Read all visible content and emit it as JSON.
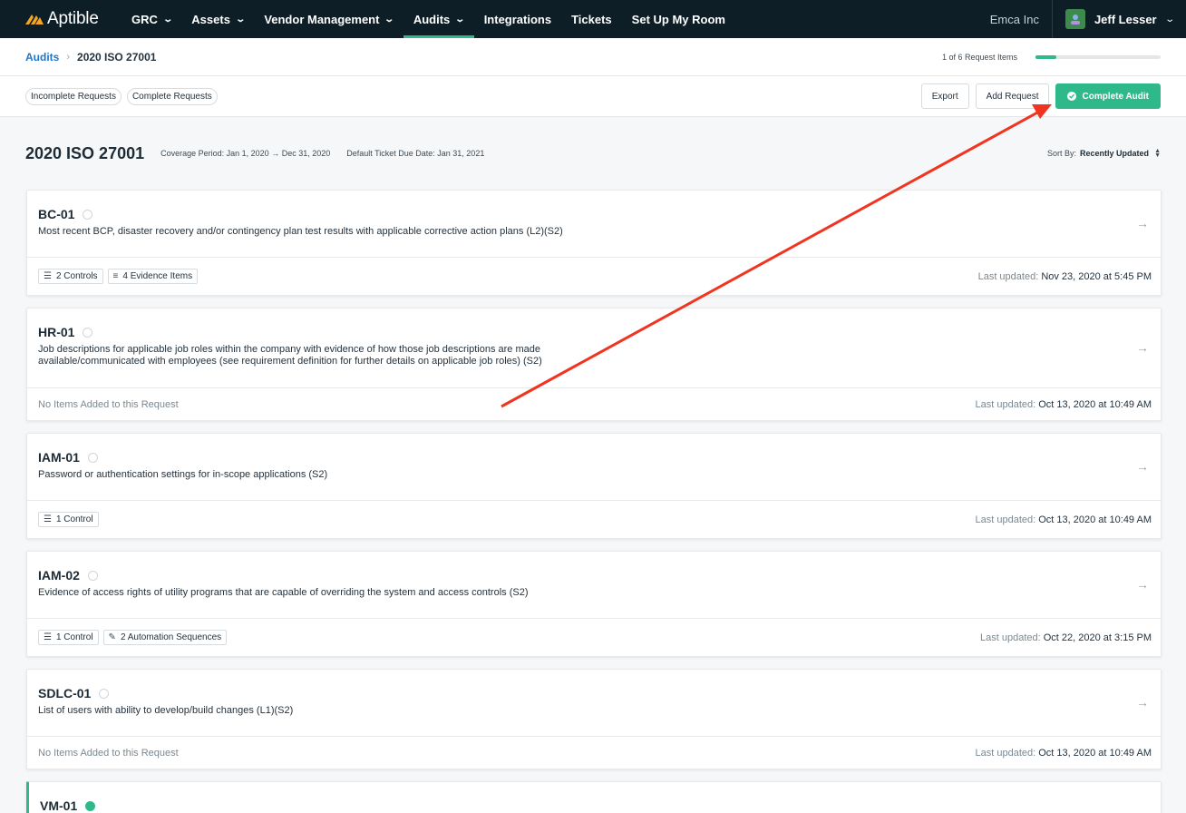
{
  "app": {
    "brand": "Aptible",
    "accent": "#2fb98a"
  },
  "nav": {
    "items": [
      {
        "label": "GRC",
        "dropdown": true
      },
      {
        "label": "Assets",
        "dropdown": true
      },
      {
        "label": "Vendor Management",
        "dropdown": true
      },
      {
        "label": "Audits",
        "dropdown": true,
        "active": true
      },
      {
        "label": "Integrations",
        "dropdown": false
      },
      {
        "label": "Tickets",
        "dropdown": false
      },
      {
        "label": "Set Up My Room",
        "dropdown": false
      }
    ],
    "org": "Emca Inc",
    "user": "Jeff Lesser"
  },
  "breadcrumb": {
    "parent": "Audits",
    "current": "2020 ISO 27001"
  },
  "progress": {
    "label": "1 of 6 Request Items",
    "fraction": 0.1667
  },
  "filters": [
    "Incomplete Requests",
    "Complete Requests"
  ],
  "actions": {
    "export": "Export",
    "add": "Add Request",
    "complete": "Complete Audit"
  },
  "header": {
    "title": "2020 ISO 27001",
    "coverage": "Coverage Period: Jan 1, 2020 → Dec 31, 2020",
    "due": "Default Ticket Due Date: Jan 31, 2021",
    "sort_label": "Sort By:",
    "sort_value": "Recently Updated"
  },
  "cards": [
    {
      "id": "BC-01",
      "desc": "Most recent BCP, disaster recovery and/or contingency plan test results with applicable corrective action plans (L2)(S2)",
      "tags": [
        {
          "icon": "list-icon",
          "label": "2 Controls"
        },
        {
          "icon": "sliders-icon",
          "label": "4 Evidence Items"
        }
      ],
      "updated_label": "Last updated:",
      "updated": "Nov 23, 2020 at 5:45 PM"
    },
    {
      "id": "HR-01",
      "desc": "Job descriptions for applicable job roles within the company with evidence of how those job descriptions are made available/communicated with employees (see requirement definition for further details on applicable job roles) (S2)",
      "empty": "No Items Added to this Request",
      "updated_label": "Last updated:",
      "updated": "Oct 13, 2020 at 10:49 AM"
    },
    {
      "id": "IAM-01",
      "desc": "Password or authentication settings for in-scope applications (S2)",
      "tags": [
        {
          "icon": "list-icon",
          "label": "1 Control"
        }
      ],
      "updated_label": "Last updated:",
      "updated": "Oct 13, 2020 at 10:49 AM"
    },
    {
      "id": "IAM-02",
      "desc": "Evidence of access rights of utility programs that are capable of overriding the system and access controls (S2)",
      "tags": [
        {
          "icon": "list-icon",
          "label": "1 Control"
        },
        {
          "icon": "wand-icon",
          "label": "2 Automation Sequences"
        }
      ],
      "updated_label": "Last updated:",
      "updated": "Oct 22, 2020 at 3:15 PM"
    },
    {
      "id": "SDLC-01",
      "desc": "List of users with ability to develop/build changes (L1)(S2)",
      "empty": "No Items Added to this Request",
      "updated_label": "Last updated:",
      "updated": "Oct 13, 2020 at 10:49 AM"
    },
    {
      "id": "VM-01",
      "complete": true
    }
  ]
}
